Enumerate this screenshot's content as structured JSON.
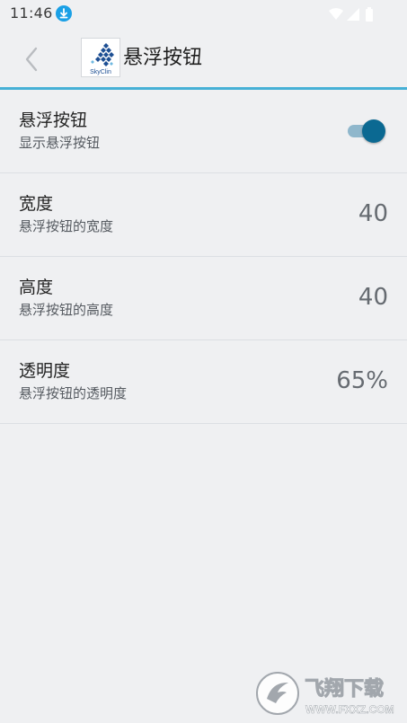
{
  "status_bar": {
    "time": "11:46",
    "icons": [
      "download-icon",
      "wifi-icon",
      "signal-icon",
      "battery-icon"
    ]
  },
  "toolbar": {
    "back_icon": "chevron-left-icon",
    "logo_text": "SkyClin",
    "title": "悬浮按钮"
  },
  "settings": [
    {
      "title": "悬浮按钮",
      "summary": "显示悬浮按钮",
      "type": "toggle",
      "enabled": true
    },
    {
      "title": "宽度",
      "summary": "悬浮按钮的宽度",
      "type": "value",
      "value": "40"
    },
    {
      "title": "高度",
      "summary": "悬浮按钮的高度",
      "type": "value",
      "value": "40"
    },
    {
      "title": "透明度",
      "summary": "悬浮按钮的透明度",
      "type": "value",
      "value": "65%"
    }
  ],
  "watermark": {
    "brand": "飞翔下载",
    "url": "WWW.FXXZ.COM"
  },
  "colors": {
    "accent": "#46b0d6",
    "toggle_thumb": "#0b6992",
    "toggle_track": "#8fb7cc",
    "background": "#eff0f2"
  }
}
